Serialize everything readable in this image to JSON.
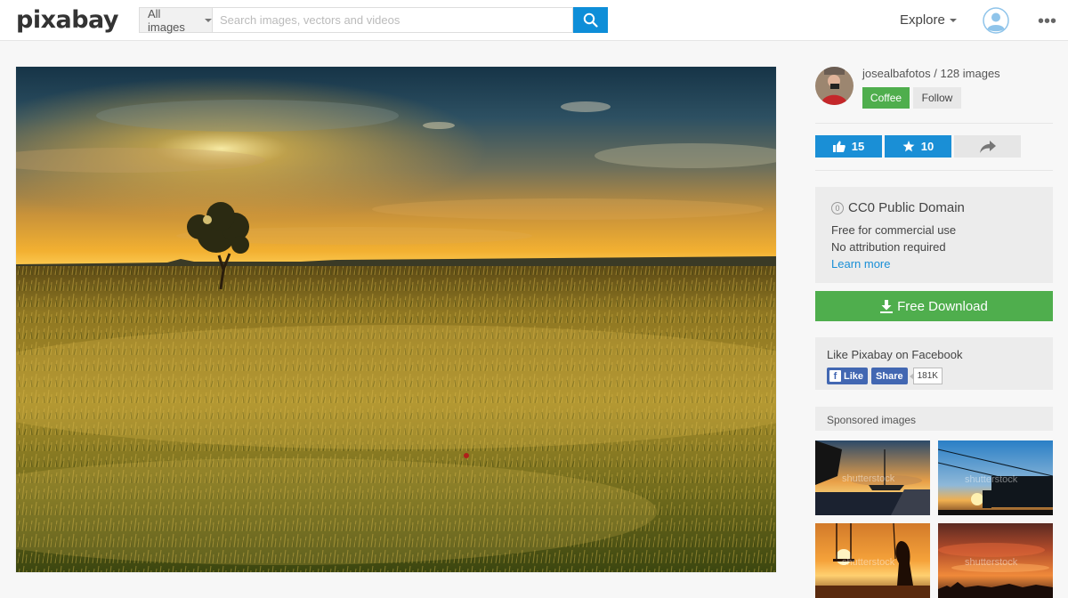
{
  "header": {
    "logo": "pixabay",
    "search_type": "All images",
    "search_placeholder": "Search images, vectors and videos",
    "explore_label": "Explore"
  },
  "author": {
    "name": "josealbafotos",
    "separator": " / ",
    "images_count": "128 images",
    "coffee_label": "Coffee",
    "follow_label": "Follow"
  },
  "actions": {
    "likes": "15",
    "favorites": "10"
  },
  "license": {
    "icon_glyph": "0",
    "title": "CC0 Public Domain",
    "line1": "Free for commercial use",
    "line2": "No attribution required",
    "learn_more": "Learn more"
  },
  "download": {
    "label": "Free Download"
  },
  "facebook": {
    "title": "Like Pixabay on Facebook",
    "like_label": "Like",
    "share_label": "Share",
    "count": "181K"
  },
  "sponsored": {
    "title": "Sponsored images",
    "watermark": "shutterstock"
  },
  "colors": {
    "accent_blue": "#0e8ed8",
    "accent_green": "#4fae4d"
  }
}
